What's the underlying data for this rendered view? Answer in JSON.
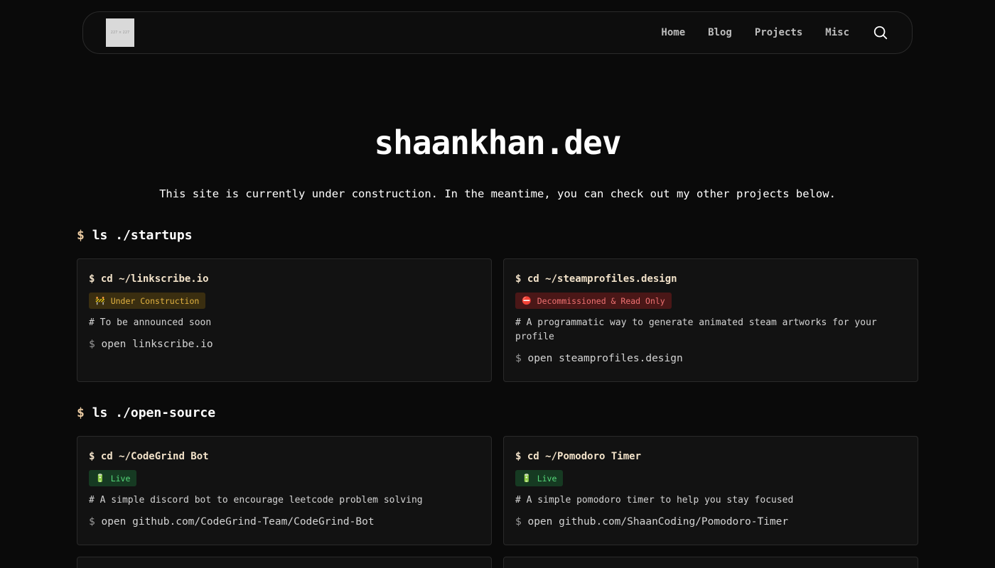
{
  "nav": {
    "logo_text": "227 × 227",
    "links": [
      "Home",
      "Blog",
      "Projects",
      "Misc"
    ]
  },
  "hero": {
    "title": "shaankhan.dev",
    "subtitle": "This site is currently under construction. In the meantime, you can check out my other projects below."
  },
  "sections": [
    {
      "prompt": "$",
      "heading": "ls ./startups",
      "cards": [
        {
          "prompt": "$",
          "title": "cd ~/linkscribe.io",
          "badge": "Under Construction",
          "badge_icon": "🚧",
          "description": "# To be announced soon",
          "cmd_prompt": "$",
          "command": "open linkscribe.io"
        },
        {
          "prompt": "$",
          "title": "cd ~/steamprofiles.design",
          "badge": "Decommissioned & Read Only",
          "badge_icon": "⛔",
          "description": "# A programmatic way to generate animated steam artworks for your profile",
          "cmd_prompt": "$",
          "command": "open steamprofiles.design"
        }
      ]
    },
    {
      "prompt": "$",
      "heading": "ls ./open-source",
      "cards": [
        {
          "prompt": "$",
          "title": "cd ~/CodeGrind Bot",
          "badge": "Live",
          "badge_icon": "🔋",
          "description": "# A simple discord bot to encourage leetcode problem solving",
          "cmd_prompt": "$",
          "command": "open github.com/CodeGrind-Team/CodeGrind-Bot"
        },
        {
          "prompt": "$",
          "title": "cd ~/Pomodoro Timer",
          "badge": "Live",
          "badge_icon": "🔋",
          "description": "# A simple pomodoro timer to help you stay focused",
          "cmd_prompt": "$",
          "command": "open github.com/ShaanCoding/Pomodoro-Timer"
        }
      ]
    }
  ],
  "colors": {
    "background": "#0a0a0a",
    "card": "#121212",
    "accent": "#e9c9a0",
    "construction": "#e3b341",
    "decommissioned": "#f07272",
    "live": "#56d97a"
  }
}
